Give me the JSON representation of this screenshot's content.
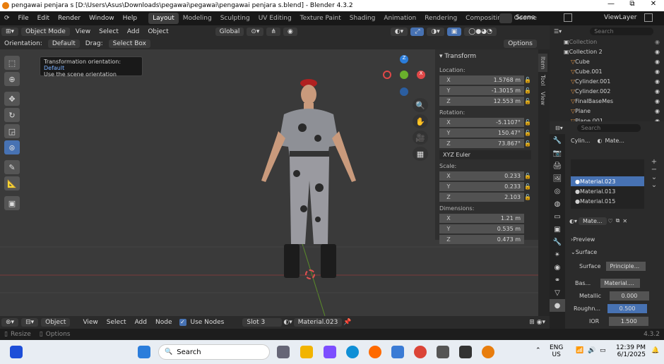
{
  "window": {
    "title": "pengawai penjara s [D:\\Users\\Asus\\Downloads\\pegawai\\pegawai\\pengawai penjara s.blend] - Blender 4.3.2",
    "minimize": "—",
    "maximize": "⧉",
    "close": "✕"
  },
  "menu": [
    "File",
    "Edit",
    "Render",
    "Window",
    "Help"
  ],
  "workspaces": [
    "Layout",
    "Modeling",
    "Sculpting",
    "UV Editing",
    "Texture Paint",
    "Shading",
    "Animation",
    "Rendering",
    "Compositing",
    "Geome"
  ],
  "scene": "Scene",
  "view_layer": "ViewLayer",
  "viewport_header": {
    "mode": "Object Mode",
    "menus": [
      "View",
      "Select",
      "Add",
      "Object"
    ],
    "transform": "Global"
  },
  "orientation_bar": {
    "orientation_label": "Orientation:",
    "orientation": "Default",
    "drag_label": "Drag:",
    "drag": "Select Box",
    "options": "Options"
  },
  "tooltip": {
    "title": "Transformation orientation:",
    "value": "Default",
    "desc": "Use the scene orientation"
  },
  "transform_panel": {
    "header": "Transform",
    "location_label": "Location:",
    "location": [
      {
        "axis": "X",
        "value": "1.5768 m"
      },
      {
        "axis": "Y",
        "value": "-1.3015 m"
      },
      {
        "axis": "Z",
        "value": "12.553 m"
      }
    ],
    "rotation_label": "Rotation:",
    "rotation": [
      {
        "axis": "X",
        "value": "-5.1107°"
      },
      {
        "axis": "Y",
        "value": "150.47°"
      },
      {
        "axis": "Z",
        "value": "73.867°"
      }
    ],
    "rotation_mode": "XYZ Euler",
    "scale_label": "Scale:",
    "scale": [
      {
        "axis": "X",
        "value": "0.233"
      },
      {
        "axis": "Y",
        "value": "0.233"
      },
      {
        "axis": "Z",
        "value": "2.103"
      }
    ],
    "dimensions_label": "Dimensions:",
    "dimensions": [
      {
        "axis": "X",
        "value": "1.21 m"
      },
      {
        "axis": "Y",
        "value": "0.535 m"
      },
      {
        "axis": "Z",
        "value": "0.473 m"
      }
    ]
  },
  "side_tabs": [
    "Item",
    "Tool",
    "View"
  ],
  "gizmo": {
    "z": "Z",
    "x": "X"
  },
  "outliner": {
    "search_placeholder": "Search",
    "items": [
      "Collection",
      "Collection 2",
      "Cube",
      "Cube.001",
      "Cylinder.001",
      "Cylinder.002",
      "FinalBaseMes",
      "Plane",
      "Plane.001"
    ]
  },
  "properties": {
    "search_placeholder": "Search",
    "breadcrumb": [
      "Cylin...",
      "Mate..."
    ],
    "slots": [
      "Material.023",
      "Material.013",
      "Material.015"
    ],
    "material_name": "Mate...",
    "preview": "Preview",
    "surface_section": "Surface",
    "surface_label": "Surface",
    "surface_value": "Principle...",
    "base_label": "Bas...",
    "base_value": "Material....",
    "metallic_label": "Metallic",
    "metallic": "0.000",
    "roughness_label": "Roughn...",
    "roughness": "0.500",
    "ior_label": "IOR",
    "ior": "1.500"
  },
  "shader_header": {
    "object": "Object",
    "menus": [
      "View",
      "Select",
      "Add",
      "Node"
    ],
    "use_nodes": "Use Nodes",
    "slot": "Slot 3",
    "material": "Material.023"
  },
  "status": {
    "resize": "Resize",
    "options": "Options",
    "version": "4.3.2"
  },
  "taskbar": {
    "search": "Search",
    "lang1": "ENG",
    "lang2": "US",
    "time": "12:39 PM",
    "date": "6/1/2025"
  }
}
